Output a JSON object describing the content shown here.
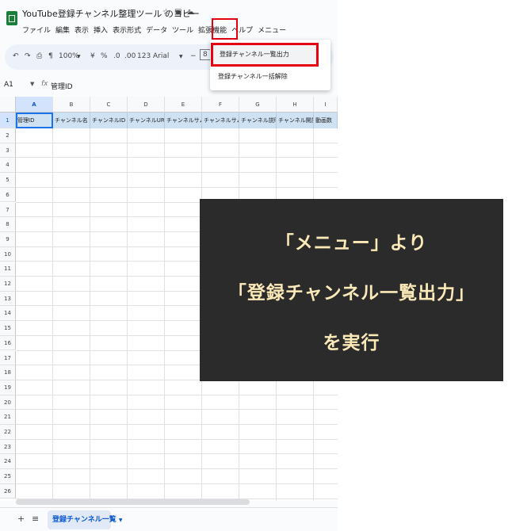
{
  "document": {
    "title": "YouTube登録チャンネル整理ツール のコピー",
    "title_icons": [
      "star-icon",
      "folder-icon",
      "cloud-icon"
    ]
  },
  "menubar": [
    "ファイル",
    "編集",
    "表示",
    "挿入",
    "表示形式",
    "データ",
    "ツール",
    "拡張機能",
    "ヘルプ",
    "メニュー"
  ],
  "toolbar": {
    "zoom": "100%",
    "currency": "¥",
    "percent": "%",
    "dec_decrease": ".0",
    "dec_increase": ".00",
    "number_format": "123",
    "font": "Arial",
    "minus": "−",
    "font_size": "8"
  },
  "formula_bar": {
    "name_box": "A1",
    "fx": "fx",
    "value": "管理ID"
  },
  "columns": [
    "A",
    "B",
    "C",
    "D",
    "E",
    "F",
    "G",
    "H",
    "I"
  ],
  "header_row": [
    "管理ID",
    "チャンネル名",
    "チャンネルID",
    "チャンネルURL",
    "チャンネルサムネイル",
    "チャンネルサムネイル",
    "チャンネル説明",
    "チャンネル開設日",
    "動画数"
  ],
  "row_numbers": [
    "1",
    "2",
    "3",
    "4",
    "5",
    "6",
    "7",
    "8",
    "9",
    "10",
    "11",
    "12",
    "13",
    "14",
    "15",
    "16",
    "17",
    "18",
    "19",
    "20",
    "21",
    "22",
    "23",
    "24",
    "25",
    "26"
  ],
  "dropdown": {
    "item1": "登録チャンネル一覧出力",
    "item2": "登録チャンネル一括解除"
  },
  "sheet_bar": {
    "add": "+",
    "all_sheets": "≡",
    "active_tab": "登録チャンネル一覧"
  },
  "overlay": {
    "line1": "「メニュー」より",
    "line2": "「登録チャンネル一覧出力」",
    "line3": "を実行"
  },
  "colors": {
    "highlight_red": "#e50012",
    "overlay_bg": "#2b2b2b",
    "overlay_text": "#fbe9b8",
    "header_fill": "#cfe2f3",
    "sheets_green": "#188038"
  }
}
